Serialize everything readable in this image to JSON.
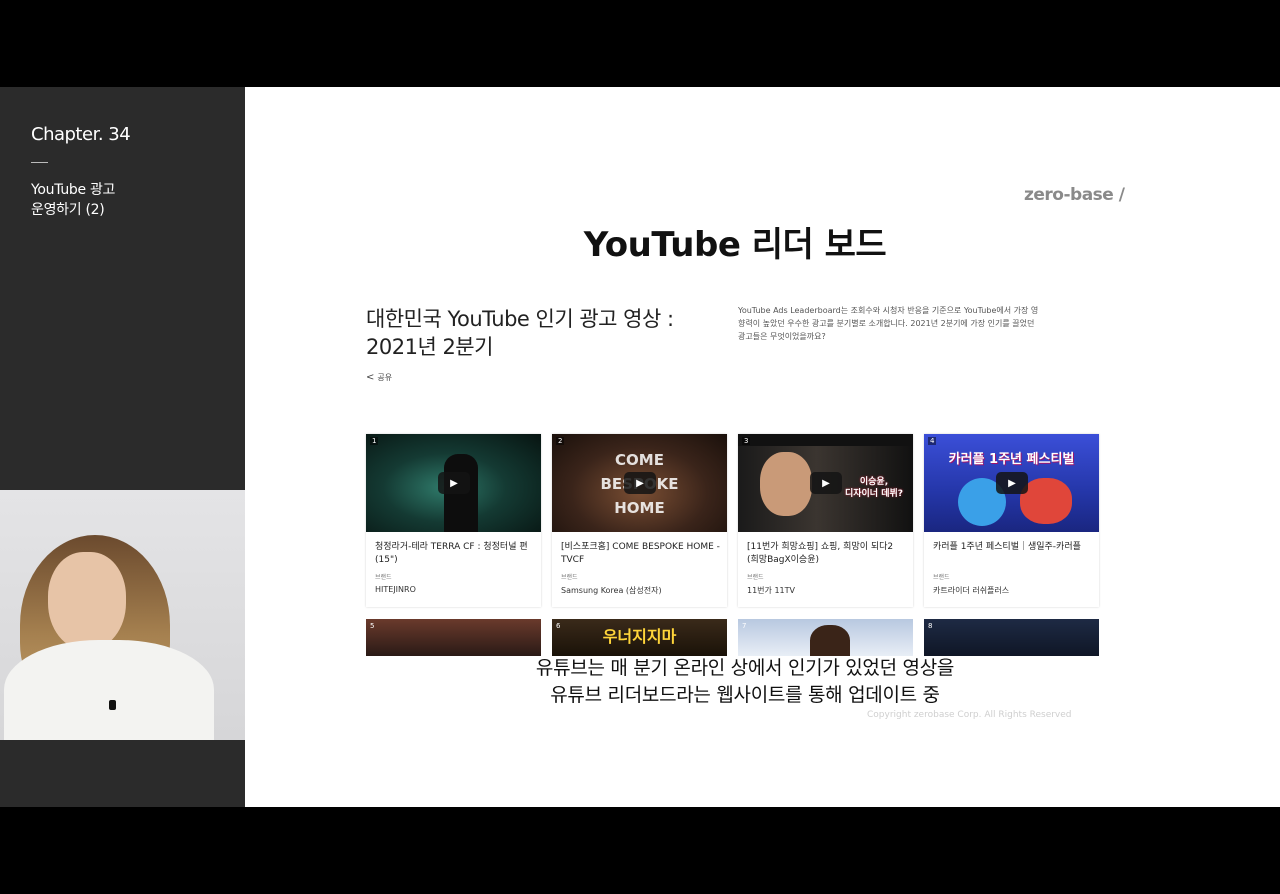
{
  "sidebar": {
    "chapter": "Chapter. 34",
    "lecture_title": "YouTube 광고\n운영하기 (2)"
  },
  "slide": {
    "brand": "zero-base /",
    "title": "YouTube 리더 보드",
    "page_heading": "대한민국 YouTube 인기 광고 영상 :\n2021년 2분기",
    "share_label": "공유",
    "description": "YouTube Ads Leaderboard는 조회수와 시청자 반응을 기준으로 YouTube에서 가장 영향력이 높았던 우수한 광고를 분기별로 소개합니다. 2021년 2분기에 가장 인기를 끌었던 광고들은 무엇이었을까요?",
    "cards": [
      {
        "rank": "1",
        "title": "청정라거-테라 TERRA CF : 청정터널 편 (15\")",
        "brand_label": "브랜드",
        "brand": "HITEJINRO",
        "thumb_text": ""
      },
      {
        "rank": "2",
        "title": "[비스포크홈] COME BESPOKE HOME - TVCF",
        "brand_label": "브랜드",
        "brand": "Samsung Korea (삼성전자)",
        "thumb_text": "COME\nBESPOKE\nHOME"
      },
      {
        "rank": "3",
        "title": "[11번가 희망쇼핑] 쇼핑, 희망이 되다2 (희망BagX이승윤)",
        "brand_label": "브랜드",
        "brand": "11번가 11TV",
        "thumb_text": "이승윤,\n디자이너 데뷔?"
      },
      {
        "rank": "4",
        "title": "카러플 1주년 페스티벌｜생일주-카러플",
        "brand_label": "브랜드",
        "brand": "카트라이더 러쉬플러스",
        "thumb_text": "카러플 1주년 페스티벌"
      }
    ],
    "row2": [
      {
        "rank": "5",
        "thumb_text": ""
      },
      {
        "rank": "6",
        "thumb_text": "우너지지마"
      },
      {
        "rank": "7",
        "thumb_text": ""
      },
      {
        "rank": "8",
        "thumb_text": ""
      }
    ],
    "copyright": "Copyright zerobase Corp. All Rights Reserved"
  },
  "subtitle": {
    "line1": "유튜브는 매 분기 온라인 상에서 인기가 있었던 영상을",
    "line2": "유튜브 리더보드라는 웹사이트를 통해 업데이트 중"
  }
}
